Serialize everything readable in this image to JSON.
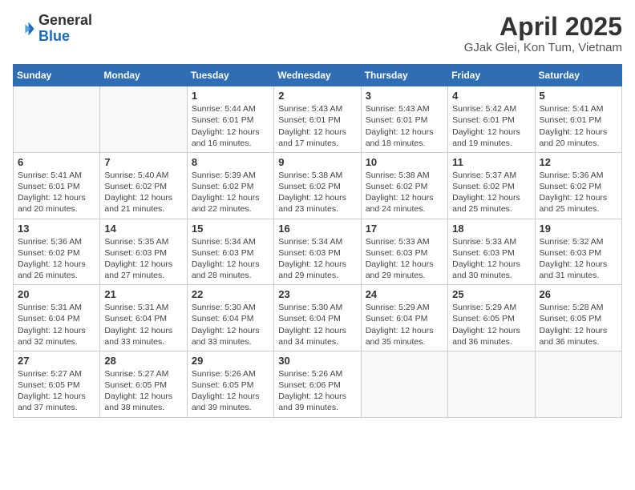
{
  "header": {
    "logo_general": "General",
    "logo_blue": "Blue",
    "month_title": "April 2025",
    "location": "GJak Glei, Kon Tum, Vietnam"
  },
  "weekdays": [
    "Sunday",
    "Monday",
    "Tuesday",
    "Wednesday",
    "Thursday",
    "Friday",
    "Saturday"
  ],
  "weeks": [
    [
      {
        "day": "",
        "info": ""
      },
      {
        "day": "",
        "info": ""
      },
      {
        "day": "1",
        "info": "Sunrise: 5:44 AM\nSunset: 6:01 PM\nDaylight: 12 hours\nand 16 minutes."
      },
      {
        "day": "2",
        "info": "Sunrise: 5:43 AM\nSunset: 6:01 PM\nDaylight: 12 hours\nand 17 minutes."
      },
      {
        "day": "3",
        "info": "Sunrise: 5:43 AM\nSunset: 6:01 PM\nDaylight: 12 hours\nand 18 minutes."
      },
      {
        "day": "4",
        "info": "Sunrise: 5:42 AM\nSunset: 6:01 PM\nDaylight: 12 hours\nand 19 minutes."
      },
      {
        "day": "5",
        "info": "Sunrise: 5:41 AM\nSunset: 6:01 PM\nDaylight: 12 hours\nand 20 minutes."
      }
    ],
    [
      {
        "day": "6",
        "info": "Sunrise: 5:41 AM\nSunset: 6:01 PM\nDaylight: 12 hours\nand 20 minutes."
      },
      {
        "day": "7",
        "info": "Sunrise: 5:40 AM\nSunset: 6:02 PM\nDaylight: 12 hours\nand 21 minutes."
      },
      {
        "day": "8",
        "info": "Sunrise: 5:39 AM\nSunset: 6:02 PM\nDaylight: 12 hours\nand 22 minutes."
      },
      {
        "day": "9",
        "info": "Sunrise: 5:38 AM\nSunset: 6:02 PM\nDaylight: 12 hours\nand 23 minutes."
      },
      {
        "day": "10",
        "info": "Sunrise: 5:38 AM\nSunset: 6:02 PM\nDaylight: 12 hours\nand 24 minutes."
      },
      {
        "day": "11",
        "info": "Sunrise: 5:37 AM\nSunset: 6:02 PM\nDaylight: 12 hours\nand 25 minutes."
      },
      {
        "day": "12",
        "info": "Sunrise: 5:36 AM\nSunset: 6:02 PM\nDaylight: 12 hours\nand 25 minutes."
      }
    ],
    [
      {
        "day": "13",
        "info": "Sunrise: 5:36 AM\nSunset: 6:02 PM\nDaylight: 12 hours\nand 26 minutes."
      },
      {
        "day": "14",
        "info": "Sunrise: 5:35 AM\nSunset: 6:03 PM\nDaylight: 12 hours\nand 27 minutes."
      },
      {
        "day": "15",
        "info": "Sunrise: 5:34 AM\nSunset: 6:03 PM\nDaylight: 12 hours\nand 28 minutes."
      },
      {
        "day": "16",
        "info": "Sunrise: 5:34 AM\nSunset: 6:03 PM\nDaylight: 12 hours\nand 29 minutes."
      },
      {
        "day": "17",
        "info": "Sunrise: 5:33 AM\nSunset: 6:03 PM\nDaylight: 12 hours\nand 29 minutes."
      },
      {
        "day": "18",
        "info": "Sunrise: 5:33 AM\nSunset: 6:03 PM\nDaylight: 12 hours\nand 30 minutes."
      },
      {
        "day": "19",
        "info": "Sunrise: 5:32 AM\nSunset: 6:03 PM\nDaylight: 12 hours\nand 31 minutes."
      }
    ],
    [
      {
        "day": "20",
        "info": "Sunrise: 5:31 AM\nSunset: 6:04 PM\nDaylight: 12 hours\nand 32 minutes."
      },
      {
        "day": "21",
        "info": "Sunrise: 5:31 AM\nSunset: 6:04 PM\nDaylight: 12 hours\nand 33 minutes."
      },
      {
        "day": "22",
        "info": "Sunrise: 5:30 AM\nSunset: 6:04 PM\nDaylight: 12 hours\nand 33 minutes."
      },
      {
        "day": "23",
        "info": "Sunrise: 5:30 AM\nSunset: 6:04 PM\nDaylight: 12 hours\nand 34 minutes."
      },
      {
        "day": "24",
        "info": "Sunrise: 5:29 AM\nSunset: 6:04 PM\nDaylight: 12 hours\nand 35 minutes."
      },
      {
        "day": "25",
        "info": "Sunrise: 5:29 AM\nSunset: 6:05 PM\nDaylight: 12 hours\nand 36 minutes."
      },
      {
        "day": "26",
        "info": "Sunrise: 5:28 AM\nSunset: 6:05 PM\nDaylight: 12 hours\nand 36 minutes."
      }
    ],
    [
      {
        "day": "27",
        "info": "Sunrise: 5:27 AM\nSunset: 6:05 PM\nDaylight: 12 hours\nand 37 minutes."
      },
      {
        "day": "28",
        "info": "Sunrise: 5:27 AM\nSunset: 6:05 PM\nDaylight: 12 hours\nand 38 minutes."
      },
      {
        "day": "29",
        "info": "Sunrise: 5:26 AM\nSunset: 6:05 PM\nDaylight: 12 hours\nand 39 minutes."
      },
      {
        "day": "30",
        "info": "Sunrise: 5:26 AM\nSunset: 6:06 PM\nDaylight: 12 hours\nand 39 minutes."
      },
      {
        "day": "",
        "info": ""
      },
      {
        "day": "",
        "info": ""
      },
      {
        "day": "",
        "info": ""
      }
    ]
  ]
}
